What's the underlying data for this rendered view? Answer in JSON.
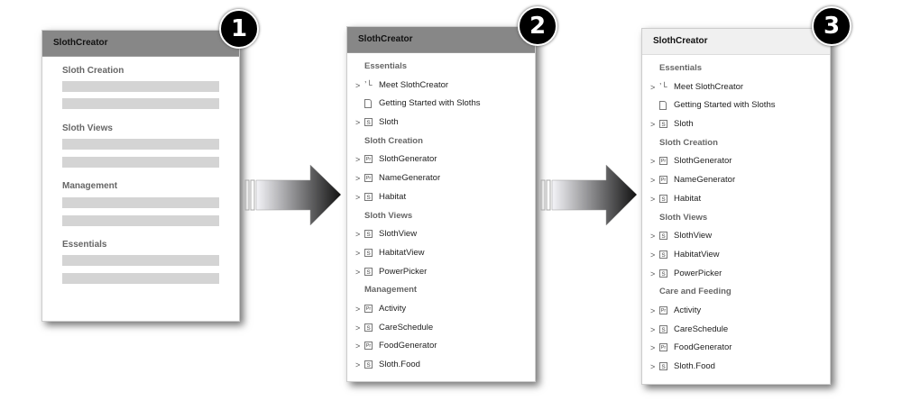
{
  "panels": [
    {
      "title": "SlothCreator",
      "badge": "1",
      "sections": [
        "Sloth Creation",
        "Sloth Views",
        "Management",
        "Essentials"
      ]
    },
    {
      "title": "SlothCreator",
      "badge": "2",
      "rows": [
        {
          "type": "section",
          "label": "Essentials"
        },
        {
          "type": "item",
          "icon": "tutorial",
          "chevron": true,
          "label": "Meet SlothCreator"
        },
        {
          "type": "item",
          "icon": "document",
          "chevron": false,
          "label": "Getting Started with Sloths"
        },
        {
          "type": "item",
          "icon": "S",
          "chevron": true,
          "label": "Sloth"
        },
        {
          "type": "section",
          "label": "Sloth Creation"
        },
        {
          "type": "item",
          "icon": "Pr",
          "chevron": true,
          "label": "SlothGenerator"
        },
        {
          "type": "item",
          "icon": "Pr",
          "chevron": true,
          "label": "NameGenerator"
        },
        {
          "type": "item",
          "icon": "S",
          "chevron": true,
          "label": "Habitat"
        },
        {
          "type": "section",
          "label": "Sloth Views"
        },
        {
          "type": "item",
          "icon": "S",
          "chevron": true,
          "label": "SlothView"
        },
        {
          "type": "item",
          "icon": "S",
          "chevron": true,
          "label": "HabitatView"
        },
        {
          "type": "item",
          "icon": "S",
          "chevron": true,
          "label": "PowerPicker"
        },
        {
          "type": "section",
          "label": "Management"
        },
        {
          "type": "item",
          "icon": "Pr",
          "chevron": true,
          "label": "Activity"
        },
        {
          "type": "item",
          "icon": "S",
          "chevron": true,
          "label": "CareSchedule"
        },
        {
          "type": "item",
          "icon": "Pr",
          "chevron": true,
          "label": "FoodGenerator"
        },
        {
          "type": "item",
          "icon": "S",
          "chevron": true,
          "label": "Sloth.Food"
        }
      ]
    },
    {
      "title": "SlothCreator",
      "badge": "3",
      "rows": [
        {
          "type": "section",
          "label": "Essentials"
        },
        {
          "type": "item",
          "icon": "tutorial",
          "chevron": true,
          "label": "Meet SlothCreator"
        },
        {
          "type": "item",
          "icon": "document",
          "chevron": false,
          "label": "Getting Started with Sloths"
        },
        {
          "type": "item",
          "icon": "S",
          "chevron": true,
          "label": "Sloth"
        },
        {
          "type": "section",
          "label": "Sloth Creation"
        },
        {
          "type": "item",
          "icon": "Pr",
          "chevron": true,
          "label": "SlothGenerator"
        },
        {
          "type": "item",
          "icon": "Pr",
          "chevron": true,
          "label": "NameGenerator"
        },
        {
          "type": "item",
          "icon": "S",
          "chevron": true,
          "label": "Habitat"
        },
        {
          "type": "section",
          "label": "Sloth Views"
        },
        {
          "type": "item",
          "icon": "S",
          "chevron": true,
          "label": "SlothView"
        },
        {
          "type": "item",
          "icon": "S",
          "chevron": true,
          "label": "HabitatView"
        },
        {
          "type": "item",
          "icon": "S",
          "chevron": true,
          "label": "PowerPicker"
        },
        {
          "type": "section",
          "label": "Care and Feeding"
        },
        {
          "type": "item",
          "icon": "Pr",
          "chevron": true,
          "label": "Activity"
        },
        {
          "type": "item",
          "icon": "S",
          "chevron": true,
          "label": "CareSchedule"
        },
        {
          "type": "item",
          "icon": "Pr",
          "chevron": true,
          "label": "FoodGenerator"
        },
        {
          "type": "item",
          "icon": "S",
          "chevron": true,
          "label": "Sloth.Food"
        }
      ]
    }
  ],
  "chevron_glyph": ">",
  "colors": {
    "header_dark": "#878787",
    "header_light": "#f0f0f0",
    "placeholder_bar": "#d4d4d4"
  }
}
